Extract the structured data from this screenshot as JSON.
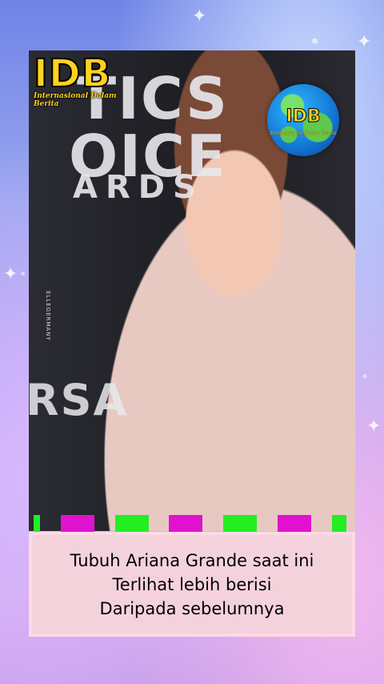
{
  "logo": {
    "big": "IDB",
    "small": "Internasional Dalam Berita"
  },
  "globe": {
    "big": "IDB",
    "small": "Internasional Dalam Berita"
  },
  "background_text": {
    "line1": "TICS",
    "line2": "OICE",
    "line3": "ARDS",
    "line4": "RSA",
    "vertical": "ELLEGERMANY"
  },
  "caption": {
    "line1": "Tubuh Ariana Grande saat ini",
    "line2": "Terlihat lebih berisi",
    "line3": "Daripada sebelumnya"
  },
  "colors": {
    "logo_yellow": "#ffd21f",
    "bar_green": "#22ee22",
    "bar_magenta": "#e012d0",
    "caption_bg": "#f4d2dc"
  },
  "progress_bars": [
    {
      "color": "green"
    },
    {
      "color": "magenta"
    },
    {
      "color": "green"
    },
    {
      "color": "magenta"
    },
    {
      "color": "green"
    },
    {
      "color": "magenta"
    },
    {
      "color": "green"
    }
  ]
}
